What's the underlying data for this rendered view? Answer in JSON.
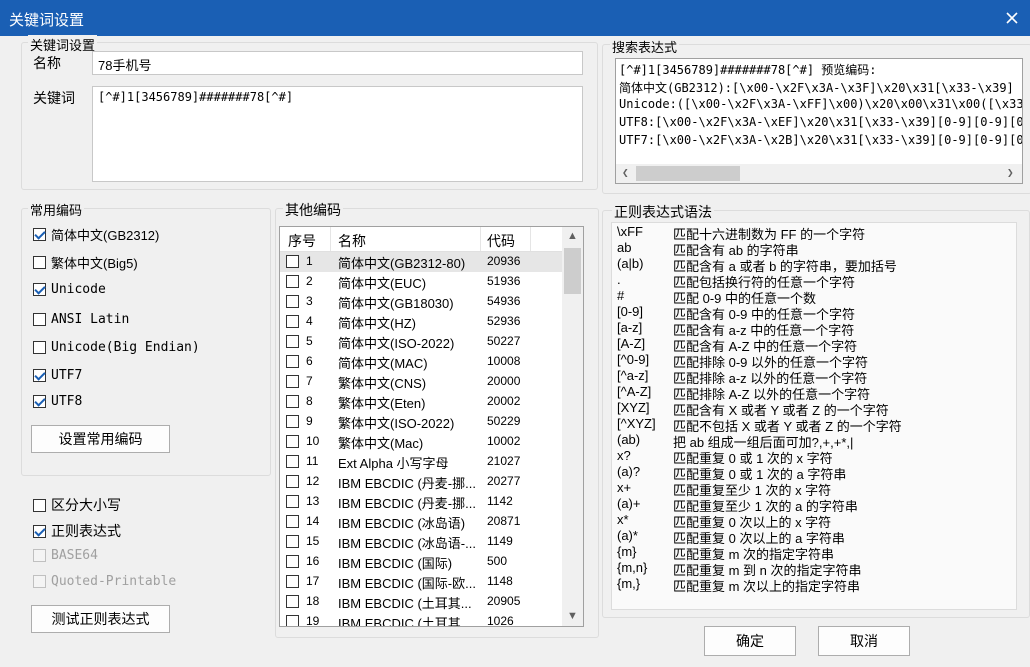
{
  "window": {
    "title": "关键词设置"
  },
  "keyword_group": {
    "label": "关键词设置",
    "name_label": "名称",
    "name_value": "78手机号",
    "keyword_label": "关键词",
    "keyword_value": "[^#]1[3456789]#######78[^#]"
  },
  "search_group": {
    "label": "搜索表达式",
    "lines": [
      "[^#]1[3456789]#######78[^#] 预览编码:",
      "简体中文(GB2312):[\\x00-\\x2F\\x3A-\\x3F]\\x20\\x31[\\x33-\\x39]",
      "Unicode:([\\x00-\\x2F\\x3A-\\xFF]\\x00)\\x20\\x00\\x31\\x00([\\x33",
      "UTF8:[\\x00-\\x2F\\x3A-\\xEF]\\x20\\x31[\\x33-\\x39][0-9][0-9][0",
      "UTF7:[\\x00-\\x2F\\x3A-\\x2B]\\x20\\x31[\\x33-\\x39][0-9][0-9][0"
    ]
  },
  "common_enc": {
    "label": "常用编码",
    "items": [
      {
        "label": "简体中文(GB2312)",
        "checked": true
      },
      {
        "label": "繁体中文(Big5)",
        "checked": false
      },
      {
        "label": "Unicode",
        "checked": true
      },
      {
        "label": "ANSI Latin",
        "checked": false
      },
      {
        "label": "Unicode(Big Endian)",
        "checked": false
      },
      {
        "label": "UTF7",
        "checked": true
      },
      {
        "label": "UTF8",
        "checked": true
      }
    ],
    "set_button": "设置常用编码"
  },
  "options": {
    "case_sensitive": "区分大小写",
    "regex": "正则表达式",
    "base64": "BASE64",
    "qp": "Quoted-Printable",
    "test_button": "测试正则表达式"
  },
  "other_enc": {
    "label": "其他编码",
    "headers": {
      "num": "序号",
      "name": "名称",
      "code": "代码"
    },
    "rows": [
      {
        "num": "1",
        "name": "简体中文(GB2312-80)",
        "code": "20936"
      },
      {
        "num": "2",
        "name": "简体中文(EUC)",
        "code": "51936"
      },
      {
        "num": "3",
        "name": "简体中文(GB18030)",
        "code": "54936"
      },
      {
        "num": "4",
        "name": "简体中文(HZ)",
        "code": "52936"
      },
      {
        "num": "5",
        "name": "简体中文(ISO-2022)",
        "code": "50227"
      },
      {
        "num": "6",
        "name": "简体中文(MAC)",
        "code": "10008"
      },
      {
        "num": "7",
        "name": "繁体中文(CNS)",
        "code": "20000"
      },
      {
        "num": "8",
        "name": "繁体中文(Eten)",
        "code": "20002"
      },
      {
        "num": "9",
        "name": "繁体中文(ISO-2022)",
        "code": "50229"
      },
      {
        "num": "10",
        "name": "繁体中文(Mac)",
        "code": "10002"
      },
      {
        "num": "11",
        "name": "Ext Alpha 小写字母",
        "code": "21027"
      },
      {
        "num": "12",
        "name": "IBM EBCDIC (丹麦-挪...",
        "code": "20277"
      },
      {
        "num": "13",
        "name": "IBM EBCDIC (丹麦-挪...",
        "code": "1142"
      },
      {
        "num": "14",
        "name": "IBM EBCDIC (冰岛语)",
        "code": "20871"
      },
      {
        "num": "15",
        "name": "IBM EBCDIC (冰岛语-...",
        "code": "1149"
      },
      {
        "num": "16",
        "name": "IBM EBCDIC (国际)",
        "code": "500"
      },
      {
        "num": "17",
        "name": "IBM EBCDIC (国际-欧...",
        "code": "1148"
      },
      {
        "num": "18",
        "name": "IBM EBCDIC (土耳其...",
        "code": "20905"
      },
      {
        "num": "19",
        "name": "IBM EBCDIC (土耳其...",
        "code": "1026"
      }
    ]
  },
  "regex_syntax": {
    "label": "正则表达式语法",
    "rows": [
      {
        "p": "\\xFF",
        "d": "匹配十六进制数为 FF 的一个字符"
      },
      {
        "p": "ab",
        "d": "匹配含有 ab 的字符串"
      },
      {
        "p": "(a|b)",
        "d": "匹配含有 a 或者 b 的字符串，要加括号"
      },
      {
        "p": ".",
        "d": "匹配包括换行符的任意一个字符"
      },
      {
        "p": "#",
        "d": "匹配 0-9 中的任意一个数"
      },
      {
        "p": "[0-9]",
        "d": "匹配含有 0-9 中的任意一个字符"
      },
      {
        "p": "[a-z]",
        "d": "匹配含有 a-z 中的任意一个字符"
      },
      {
        "p": "[A-Z]",
        "d": "匹配含有 A-Z 中的任意一个字符"
      },
      {
        "p": "[^0-9]",
        "d": "匹配排除 0-9 以外的任意一个字符"
      },
      {
        "p": "[^a-z]",
        "d": "匹配排除 a-z 以外的任意一个字符"
      },
      {
        "p": "[^A-Z]",
        "d": "匹配排除 A-Z 以外的任意一个字符"
      },
      {
        "p": "[XYZ]",
        "d": "匹配含有 X 或者 Y 或者 Z 的一个字符"
      },
      {
        "p": "[^XYZ]",
        "d": "匹配不包括 X 或者 Y 或者 Z 的一个字符"
      },
      {
        "p": "(ab)",
        "d": "把 ab 组成一组后面可加?,+,+*,|"
      },
      {
        "p": "x?",
        "d": "匹配重复 0 或 1 次的 x 字符"
      },
      {
        "p": "(a)?",
        "d": "匹配重复 0 或 1 次的 a 字符串"
      },
      {
        "p": "x+",
        "d": "匹配重复至少 1 次的 x 字符"
      },
      {
        "p": "(a)+",
        "d": "匹配重复至少 1 次的 a 的字符串"
      },
      {
        "p": "x*",
        "d": "匹配重复 0 次以上的 x 字符"
      },
      {
        "p": "(a)*",
        "d": "匹配重复 0 次以上的 a 字符串"
      },
      {
        "p": "{m}",
        "d": "匹配重复 m 次的指定字符串"
      },
      {
        "p": "{m,n}",
        "d": "匹配重复 m 到 n 次的指定字符串"
      },
      {
        "p": "{m,}",
        "d": "匹配重复 m 次以上的指定字符串"
      }
    ]
  },
  "buttons": {
    "ok": "确定",
    "cancel": "取消"
  },
  "colors": {
    "titlebar": "#1a5fb4",
    "accent": "#1a5fb4"
  }
}
